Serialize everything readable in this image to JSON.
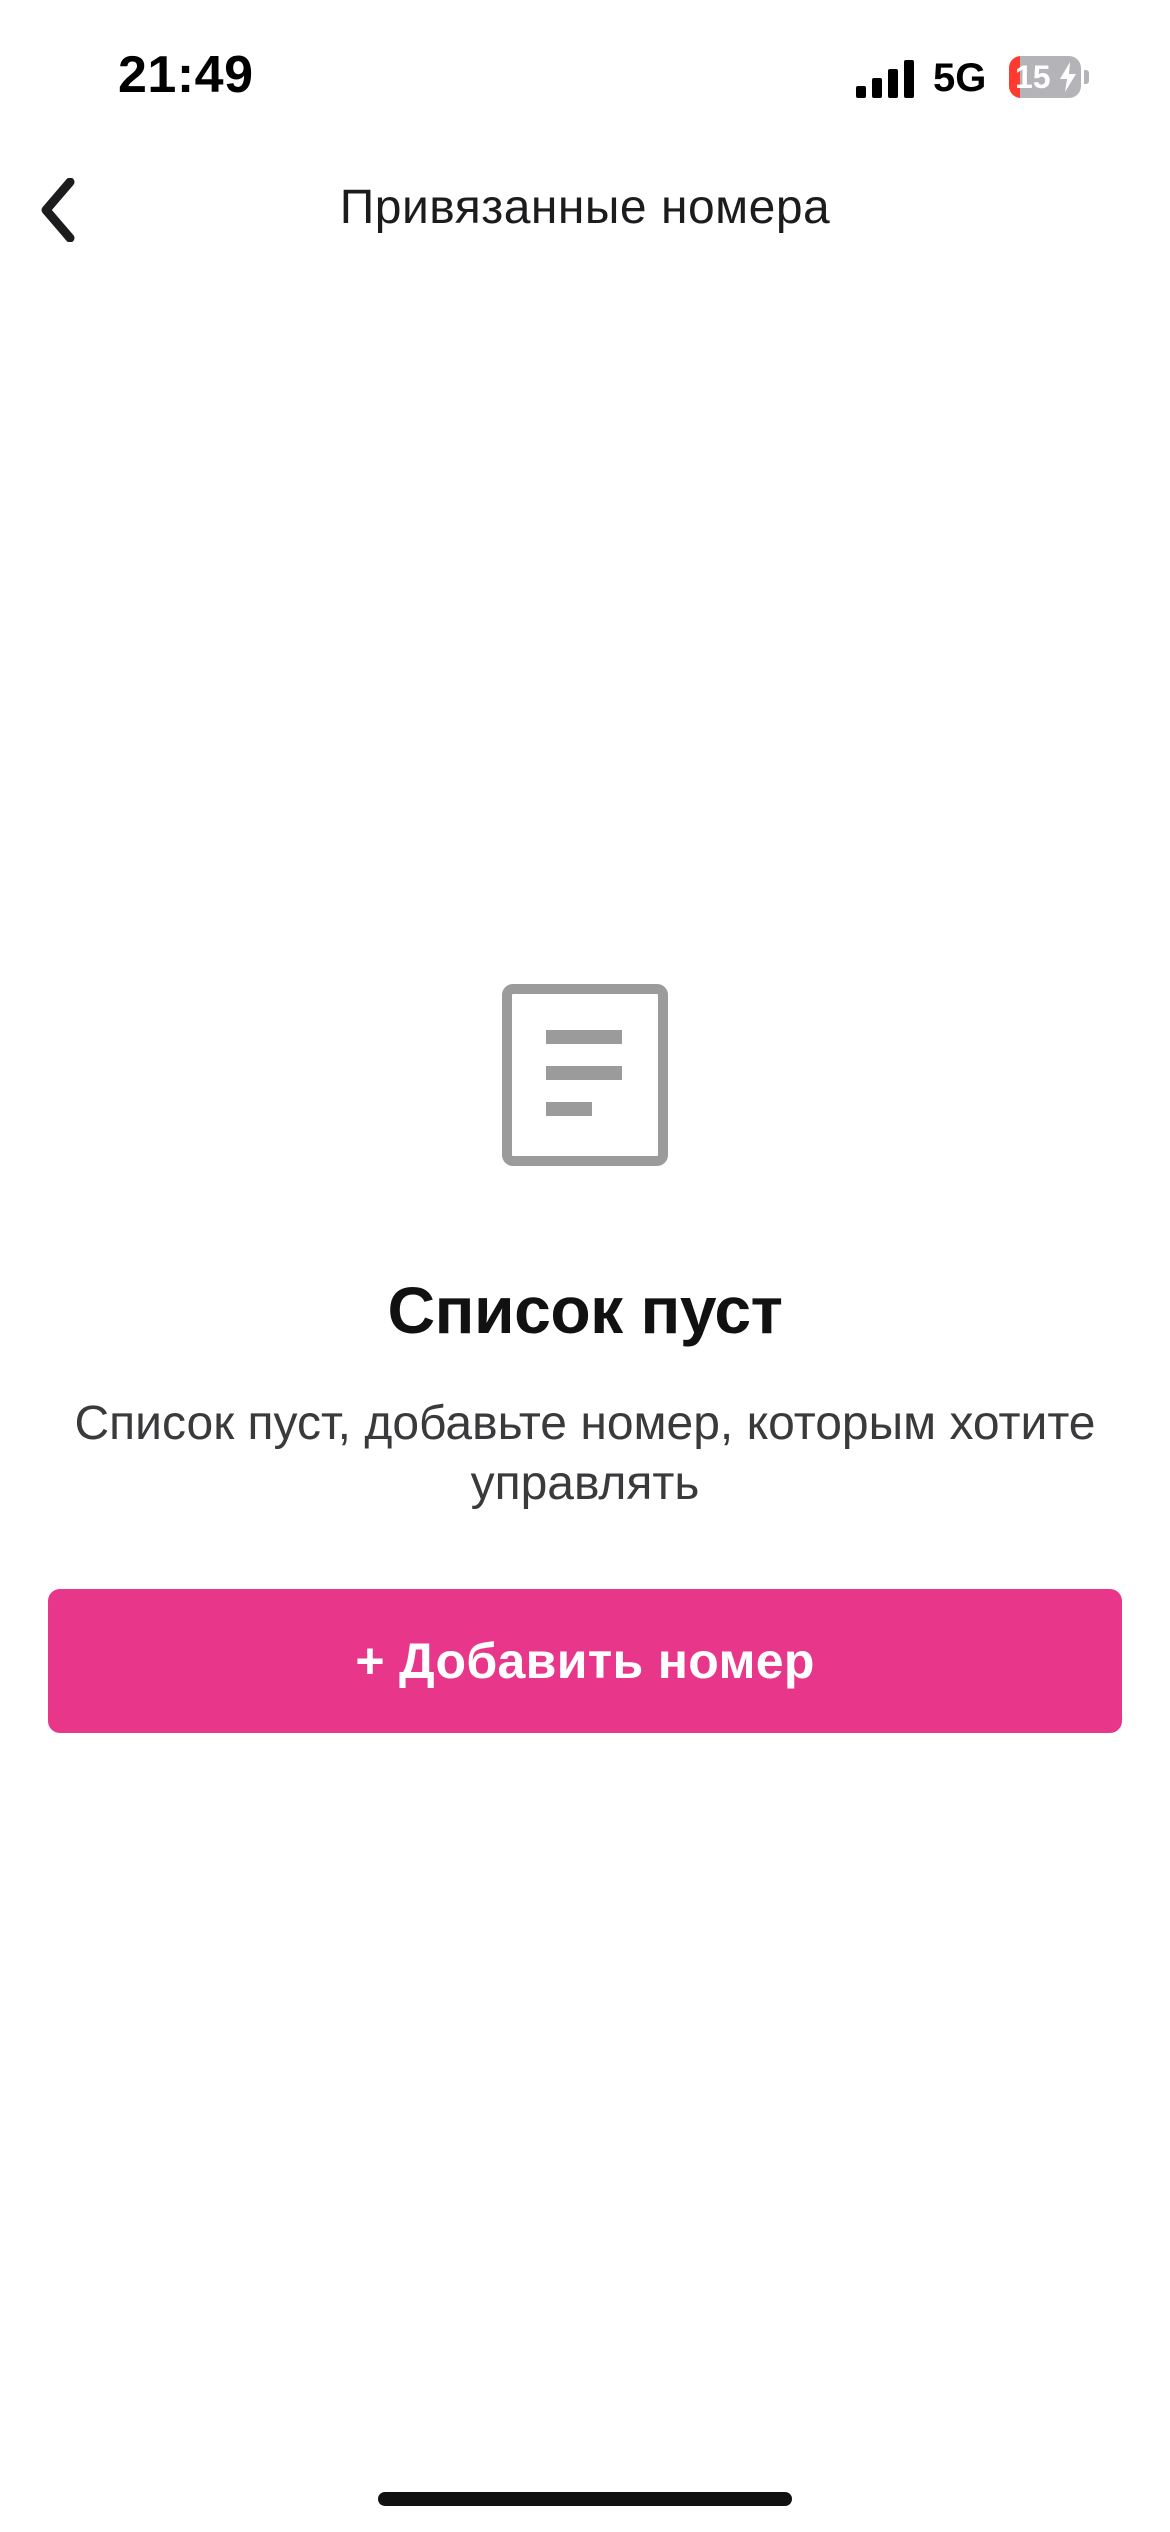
{
  "status_bar": {
    "time": "21:49",
    "network": "5G",
    "battery_level": "15",
    "battery_fraction": 0.15
  },
  "nav": {
    "title": "Привязанные номера",
    "back_icon": "chevron-left-icon"
  },
  "empty_state": {
    "icon": "document-icon",
    "title": "Список пуст",
    "subtitle": "Список пуст, добавьте номер, которым хотите управлять"
  },
  "actions": {
    "add_number_label": "+ Добавить номер"
  },
  "colors": {
    "accent": "#e8368a",
    "icon_gray": "#9b9b9b",
    "battery_low": "#ff3b30"
  }
}
